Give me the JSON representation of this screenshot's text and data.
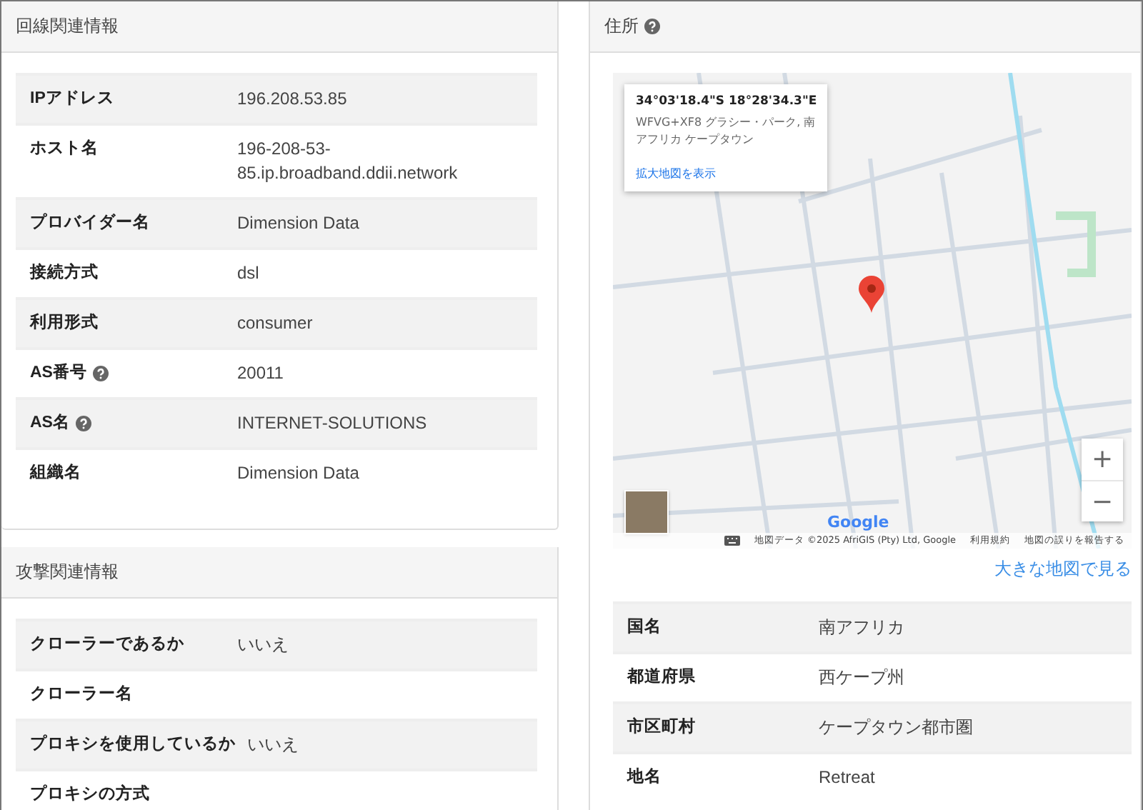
{
  "line_info": {
    "title": "回線関連情報",
    "rows": [
      {
        "label": "IPアドレス",
        "value": "196.208.53.85",
        "help": false
      },
      {
        "label": "ホスト名",
        "value": "196-208-53-85.ip.broadband.ddii.network",
        "help": false
      },
      {
        "label": "プロバイダー名",
        "value": "Dimension Data",
        "help": false
      },
      {
        "label": "接続方式",
        "value": "dsl",
        "help": false
      },
      {
        "label": "利用形式",
        "value": "consumer",
        "help": false
      },
      {
        "label": "AS番号",
        "value": "20011",
        "help": true
      },
      {
        "label": "AS名",
        "value": "INTERNET-SOLUTIONS",
        "help": true
      },
      {
        "label": "組織名",
        "value": "Dimension Data",
        "help": false
      }
    ]
  },
  "attack_info": {
    "title": "攻撃関連情報",
    "rows": [
      {
        "label": "クローラーであるか",
        "value": "いいえ",
        "help": false
      },
      {
        "label": "クローラー名",
        "help": false
      },
      {
        "label": "プロキシを使用しているか",
        "value": "いいえ",
        "help": false
      },
      {
        "label": "プロキシの方式",
        "help": false
      }
    ]
  },
  "address": {
    "title": "住所",
    "help": true,
    "map": {
      "popup": {
        "coordinates": "34°03'18.4\"S 18°28'34.3\"E",
        "address": "WFVG+XF8 グラシー・パーク, 南アフリカ ケープタウン",
        "link": "拡大地図を表示"
      },
      "zoom_buttons": [
        "+",
        "−"
      ],
      "logo": "Google",
      "attribution": "地図データ ©2025 AfriGIS (Pty) Ltd, Google",
      "terms": "利用規約",
      "report": "地図の誤りを報告する"
    },
    "larger_map_link": "大きな地図で見る",
    "rows": [
      {
        "label": "国名",
        "value": "南アフリカ",
        "help": false
      },
      {
        "label": "都道府県",
        "value": "西ケープ州",
        "help": false
      },
      {
        "label": "市区町村",
        "value": "ケープタウン都市圏",
        "help": false
      },
      {
        "label": "地名",
        "value": "Retreat",
        "help": false
      }
    ]
  }
}
